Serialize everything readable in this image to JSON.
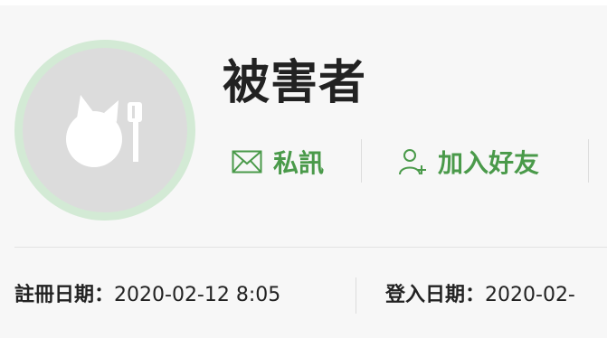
{
  "profile": {
    "username": "被害者",
    "avatar_description_icon": "default-avatar-bomb-icon"
  },
  "actions": {
    "message": {
      "label": "私訊",
      "icon": "mail-icon"
    },
    "add_friend": {
      "label": "加入好友",
      "icon": "add-user-icon"
    }
  },
  "info": {
    "registered_label": "註冊日期：",
    "registered_value": "2020-02-12 8:05",
    "login_label": "登入日期：",
    "login_value": "2020-02-"
  },
  "colors": {
    "accent_green": "#4a9a4a",
    "avatar_ring": "#d3ead5",
    "avatar_bg": "#dcdcdc",
    "page_bg": "#f7f7f7"
  }
}
